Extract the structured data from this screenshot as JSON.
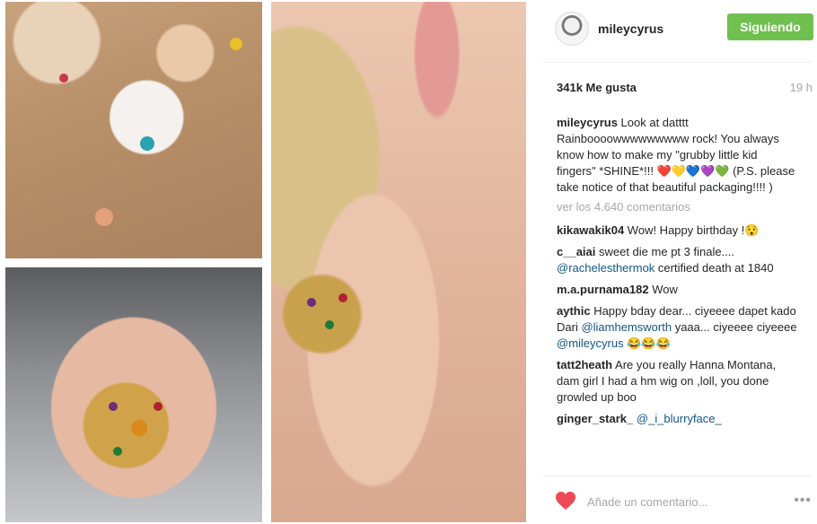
{
  "post": {
    "username": "mileycyrus",
    "follow_label": "Siguiendo",
    "likes": "341k Me gusta",
    "time": "19 h"
  },
  "caption": {
    "username": "mileycyrus",
    "text": " Look at datttt Rainboooowwwwwwwww rock! You always know how to make my \"grubby little kid fingers\" *SHINE*!!! ❤️💛💙💜💚 (P.S. please take notice of that beautiful packaging!!!! )"
  },
  "view_all": "ver los 4.640 comentarios",
  "comments": [
    {
      "username": "kikawakik04",
      "text": " Wow! Happy birthday !😯"
    },
    {
      "username": "c__aiai",
      "text": " sweet die me pt 3 finale.... ",
      "mention": "@rachelesthermok",
      "text2": " certified death at 1840"
    },
    {
      "username": "m.a.purnama182",
      "text": " Wow"
    },
    {
      "username": "aythic",
      "text": " Happy bday dear... ciyeeee dapet kado Dari ",
      "mention": "@liamhemsworth",
      "text2": " yaaa... ciyeeee ciyeeee ",
      "mention2": "@mileycyrus",
      "text3": " 😂😂😂"
    },
    {
      "username": "tatt2heath",
      "text": " Are you really Hanna Montana, dam girl I had a hm wig on ,loll, you done growled up boo"
    },
    {
      "username": "ginger_stark_",
      "text": " ",
      "mention": "@_i_blurryface_"
    }
  ],
  "add_comment": {
    "placeholder": "Añade un comentario...",
    "more_icon": "•••"
  },
  "icons": {
    "heart": "heart-icon",
    "more": "more-options-icon"
  },
  "colors": {
    "follow_button": "#70c050",
    "heart": "#ed4956",
    "mention": "#125688"
  }
}
